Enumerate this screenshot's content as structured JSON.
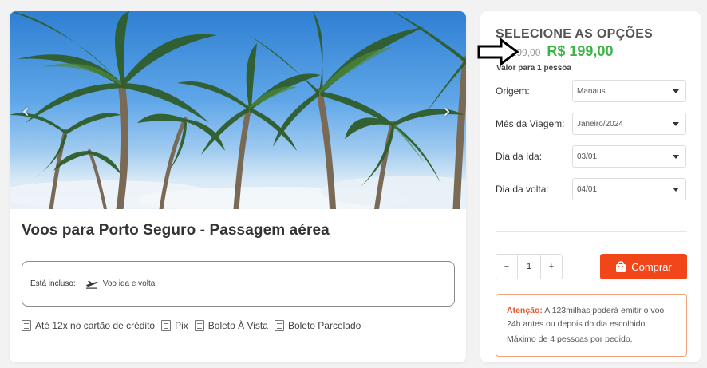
{
  "product": {
    "title": "Voos para Porto Seguro - Passagem aérea",
    "carousel_prev": "‹",
    "carousel_next": "›"
  },
  "included": {
    "label": "Está incluso:",
    "item": "Voo ida e volta",
    "icon": "plane-icon"
  },
  "payments": [
    {
      "label": "Até 12x no cartão de crédito",
      "icon": "receipt-icon"
    },
    {
      "label": "Pix",
      "icon": "receipt-icon"
    },
    {
      "label": "Boleto À Vista",
      "icon": "receipt-icon"
    },
    {
      "label": "Boleto Parcelado",
      "icon": "receipt-icon"
    }
  ],
  "options": {
    "title": "SELECIONE AS OPÇÕES",
    "old_price": "R$ 299,00",
    "new_price": "R$ 199,00",
    "price_note": "Valor para 1 pessoa"
  },
  "fields": [
    {
      "label": "Origem:",
      "value": "Manaus"
    },
    {
      "label": "Mês da Viagem:",
      "value": "Janeiro/2024"
    },
    {
      "label": "Dia da Ida:",
      "value": "03/01"
    },
    {
      "label": "Dia da volta:",
      "value": "04/01"
    }
  ],
  "quantity": {
    "minus": "−",
    "value": "1",
    "plus": "+"
  },
  "buy_button": {
    "label": "Comprar",
    "icon": "shopping-bag-icon"
  },
  "attention": {
    "prefix": "Atenção:",
    "text": " A 123milhas poderá emitir o voo 24h antes ou depois do dia escolhido.",
    "text2": "Máximo de 4 pessoas por pedido."
  },
  "colors": {
    "accent": "#f0461a",
    "price_green": "#3fb24a",
    "attention_border": "#f0a37e"
  }
}
